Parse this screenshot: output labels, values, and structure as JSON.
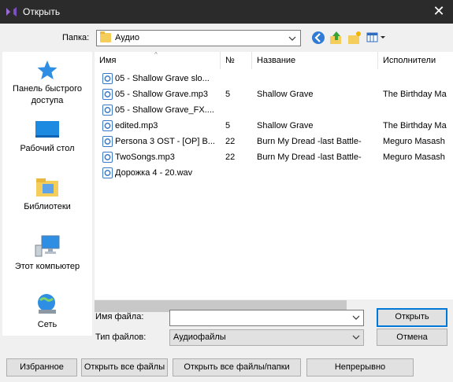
{
  "window": {
    "title": "Открыть",
    "close_glyph": "✕"
  },
  "toolbar": {
    "folder_label": "Папка:",
    "folder_value": "Аудио",
    "icons": [
      "back-icon",
      "up-folder-icon",
      "new-folder-icon",
      "view-menu-icon"
    ]
  },
  "places": [
    {
      "label": "Панель быстрого доступа",
      "icon": "quick-access-star-icon"
    },
    {
      "label": "Рабочий стол",
      "icon": "desktop-icon"
    },
    {
      "label": "Библиотеки",
      "icon": "libraries-icon"
    },
    {
      "label": "Этот компьютер",
      "icon": "computer-icon"
    },
    {
      "label": "Сеть",
      "icon": "network-icon"
    }
  ],
  "filelist": {
    "columns": [
      "Имя",
      "№",
      "Название",
      "Исполнители"
    ],
    "sort_indicator": "^",
    "rows": [
      {
        "name": "05 - Shallow Grave slo...",
        "num": "",
        "title": "",
        "artist": ""
      },
      {
        "name": "05 - Shallow Grave.mp3",
        "num": "5",
        "title": "Shallow Grave",
        "artist": "The Birthday Ma"
      },
      {
        "name": "05 - Shallow Grave_FX....",
        "num": "",
        "title": "",
        "artist": ""
      },
      {
        "name": "edited.mp3",
        "num": "5",
        "title": "Shallow Grave",
        "artist": "The Birthday Ma"
      },
      {
        "name": "Persona 3 OST - [OP] B...",
        "num": "22",
        "title": "Burn My Dread -last Battle-",
        "artist": "Meguro Masash"
      },
      {
        "name": "TwoSongs.mp3",
        "num": "22",
        "title": "Burn My Dread -last Battle-",
        "artist": "Meguro Masash"
      },
      {
        "name": "Дорожка 4 - 20.wav",
        "num": "",
        "title": "",
        "artist": ""
      }
    ]
  },
  "form": {
    "filename_label": "Имя файла:",
    "filename_value": "",
    "filetype_label": "Тип файлов:",
    "filetype_value": "Аудиофайлы",
    "open_button": "Открыть",
    "cancel_button": "Отмена"
  },
  "bottom_buttons": {
    "favorites": "Избранное",
    "open_all_files": "Открыть все файлы",
    "open_all_files_folders": "Открыть все файлы/папки",
    "continuous": "Непрерывно"
  },
  "colors": {
    "titlebar_bg": "#2b2b2b",
    "client_bg": "#f0f0f0",
    "default_button_border": "#0078d7"
  }
}
